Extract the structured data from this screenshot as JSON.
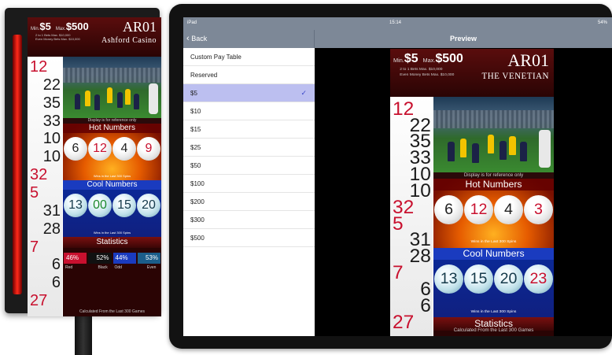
{
  "sign": {
    "min_label": "Min.",
    "min_value": "$5",
    "max_label": "Max.",
    "max_value": "$500",
    "line1": "2 to 1 Bets Max. $10,000",
    "line2": "Even Money Bets Max. $10,000",
    "table_id": "AR01",
    "casino": "Ashford Casino",
    "history": [
      {
        "v": "12",
        "c": "red",
        "side": "left"
      },
      {
        "v": "22",
        "c": "black",
        "side": "right"
      },
      {
        "v": "35",
        "c": "black",
        "side": "right"
      },
      {
        "v": "33",
        "c": "black",
        "side": "right"
      },
      {
        "v": "10",
        "c": "black",
        "side": "right"
      },
      {
        "v": "10",
        "c": "black",
        "side": "right"
      },
      {
        "v": "32",
        "c": "red",
        "side": "left"
      },
      {
        "v": "5",
        "c": "red",
        "side": "left"
      },
      {
        "v": "31",
        "c": "black",
        "side": "right"
      },
      {
        "v": "28",
        "c": "black",
        "side": "right"
      },
      {
        "v": "7",
        "c": "red",
        "side": "left"
      },
      {
        "v": "6",
        "c": "black",
        "side": "right"
      },
      {
        "v": "6",
        "c": "black",
        "side": "right"
      },
      {
        "v": "27",
        "c": "red",
        "side": "left"
      }
    ],
    "display_note": "Display is for reference only",
    "hot_title": "Hot Numbers",
    "hot": [
      {
        "v": "6",
        "c": "black"
      },
      {
        "v": "12",
        "c": "red"
      },
      {
        "v": "4",
        "c": "black"
      },
      {
        "v": "9",
        "c": "red"
      }
    ],
    "wins_note": "Wins in the Last 300 Spins",
    "cool_title": "Cool Numbers",
    "cool": [
      {
        "v": "13",
        "c": "black"
      },
      {
        "v": "00",
        "c": "green"
      },
      {
        "v": "15",
        "c": "black"
      },
      {
        "v": "20",
        "c": "black"
      }
    ],
    "stats_title": "Statistics",
    "stats": [
      {
        "pct": "46%",
        "label": "Red",
        "color": "#c8102e"
      },
      {
        "pct": "52%",
        "label": "Black",
        "color": "#111111"
      },
      {
        "pct": "44%",
        "label": "Odd",
        "color": "#1a3bbf"
      },
      {
        "pct": "53%",
        "label": "Even",
        "color": "#1b5d8a"
      }
    ],
    "calc_note": "Calculated From the Last 300 Games"
  },
  "ipad": {
    "status": {
      "carrier": "iPad",
      "time": "15:14",
      "battery": "54%"
    },
    "back_label": "Back",
    "preview_title": "Preview",
    "list": [
      {
        "label": "Custom Pay Table",
        "selected": false
      },
      {
        "label": "Reserved",
        "selected": false
      },
      {
        "label": "$5",
        "selected": true
      },
      {
        "label": "$10",
        "selected": false
      },
      {
        "label": "$15",
        "selected": false
      },
      {
        "label": "$25",
        "selected": false
      },
      {
        "label": "$50",
        "selected": false
      },
      {
        "label": "$100",
        "selected": false
      },
      {
        "label": "$200",
        "selected": false
      },
      {
        "label": "$300",
        "selected": false
      },
      {
        "label": "$500",
        "selected": false
      }
    ],
    "check_mark": "✓",
    "preview": {
      "min_label": "Min.",
      "min_value": "$5",
      "max_label": "Max.",
      "max_value": "$500",
      "line1": "2 to 1 Bets Max. $10,000",
      "line2": "Even Money Bets Max. $10,000",
      "table_id": "AR01",
      "casino": "THE VENETIAN",
      "history": [
        {
          "v": "12",
          "c": "red",
          "side": "left"
        },
        {
          "v": "22",
          "c": "black",
          "side": "right"
        },
        {
          "v": "35",
          "c": "black",
          "side": "right"
        },
        {
          "v": "33",
          "c": "black",
          "side": "right"
        },
        {
          "v": "10",
          "c": "black",
          "side": "right"
        },
        {
          "v": "10",
          "c": "black",
          "side": "right"
        },
        {
          "v": "32",
          "c": "red",
          "side": "left"
        },
        {
          "v": "5",
          "c": "red",
          "side": "left"
        },
        {
          "v": "31",
          "c": "black",
          "side": "right"
        },
        {
          "v": "28",
          "c": "black",
          "side": "right"
        },
        {
          "v": "7",
          "c": "red",
          "side": "left"
        },
        {
          "v": "6",
          "c": "black",
          "side": "right"
        },
        {
          "v": "6",
          "c": "black",
          "side": "right"
        },
        {
          "v": "27",
          "c": "red",
          "side": "left"
        }
      ],
      "display_note": "Display is for reference only",
      "hot_title": "Hot Numbers",
      "hot": [
        {
          "v": "6",
          "c": "black"
        },
        {
          "v": "12",
          "c": "red"
        },
        {
          "v": "4",
          "c": "black"
        },
        {
          "v": "3",
          "c": "red"
        }
      ],
      "wins_note": "Wins in the Last 300 Spins",
      "cool_title": "Cool Numbers",
      "cool": [
        {
          "v": "13",
          "c": "black"
        },
        {
          "v": "15",
          "c": "black"
        },
        {
          "v": "20",
          "c": "black"
        },
        {
          "v": "23",
          "c": "red"
        }
      ],
      "stats_title": "Statistics",
      "stats": [
        {
          "pct": "46%",
          "label": "Red",
          "color": "#c8102e"
        },
        {
          "pct": "52%",
          "label": "Black",
          "color": "#111111"
        },
        {
          "pct": "44%",
          "label": "Odd",
          "color": "#1a3bbf"
        },
        {
          "pct": "53%",
          "label": "Even",
          "color": "#1b5d8a"
        }
      ],
      "calc_note": "Calculated From the Last 300 Games"
    }
  }
}
